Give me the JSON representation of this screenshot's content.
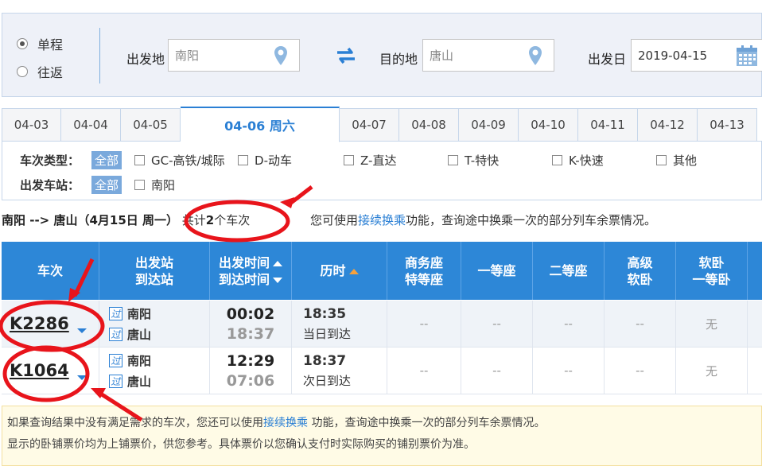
{
  "search": {
    "trip_types": [
      {
        "label": "单程",
        "checked": true
      },
      {
        "label": "往返",
        "checked": false
      }
    ],
    "from_label": "出发地",
    "from_value": "南阳",
    "to_label": "目的地",
    "to_value": "唐山",
    "date_label": "出发日",
    "date_value": "2019-04-15"
  },
  "date_tabs": [
    "04-03",
    "04-04",
    "04-05",
    "04-06 周六",
    "04-07",
    "04-08",
    "04-09",
    "04-10",
    "04-11",
    "04-12",
    "04-13"
  ],
  "active_tab_index": 3,
  "filters": {
    "type_label": "车次类型：",
    "all_label": "全部",
    "types": [
      "GC-高铁/城际",
      "D-动车",
      "Z-直达",
      "T-特快",
      "K-快速",
      "其他"
    ],
    "station_label": "出发车站：",
    "stations": [
      "南阳"
    ]
  },
  "summary": {
    "route": "南阳 --> 唐山（4月15日  周一）",
    "count_prefix": "共计",
    "count": "2",
    "count_suffix": "个车次",
    "hint_prefix": "您可使用",
    "hint_link": "接续换乘",
    "hint_suffix": "功能，查询途中换乘一次的部分列车余票情况。"
  },
  "table": {
    "headers": {
      "train": "车次",
      "station_dep": "出发站",
      "station_arr": "到达站",
      "time_dep": "出发时间",
      "time_arr": "到达时间",
      "duration": "历时",
      "business_1": "商务座",
      "business_2": "特等座",
      "first": "一等座",
      "second": "二等座",
      "senior_1": "高级",
      "senior_2": "软卧",
      "soft_1": "软卧",
      "soft_2": "一等卧"
    },
    "rows": [
      {
        "train": "K2286",
        "pass": "过",
        "from": "南阳",
        "to": "唐山",
        "dep": "00:02",
        "arr": "18:37",
        "duration": "18:35",
        "arrive_day": "当日到达",
        "business": "--",
        "first": "--",
        "second": "--",
        "senior": "--",
        "soft": "无"
      },
      {
        "train": "K1064",
        "pass": "过",
        "from": "南阳",
        "to": "唐山",
        "dep": "12:29",
        "arr": "07:06",
        "duration": "18:37",
        "arrive_day": "次日到达",
        "business": "--",
        "first": "--",
        "second": "--",
        "senior": "--",
        "soft": "无"
      }
    ]
  },
  "notice": {
    "line1_prefix": "如果查询结果中没有满足需求的车次，您还可以使用",
    "line1_link": "接续换乘",
    "line1_suffix": " 功能，查询途中换乘一次的部分列车余票情况。",
    "line2": "显示的卧铺票价均为上铺票价，供您参考。具体票价以您确认支付时实际购买的铺别票价为准。"
  },
  "colors": {
    "header_blue": "#2d87d7",
    "link_blue": "#2a7fd4",
    "annotation_red": "#e8141b"
  }
}
